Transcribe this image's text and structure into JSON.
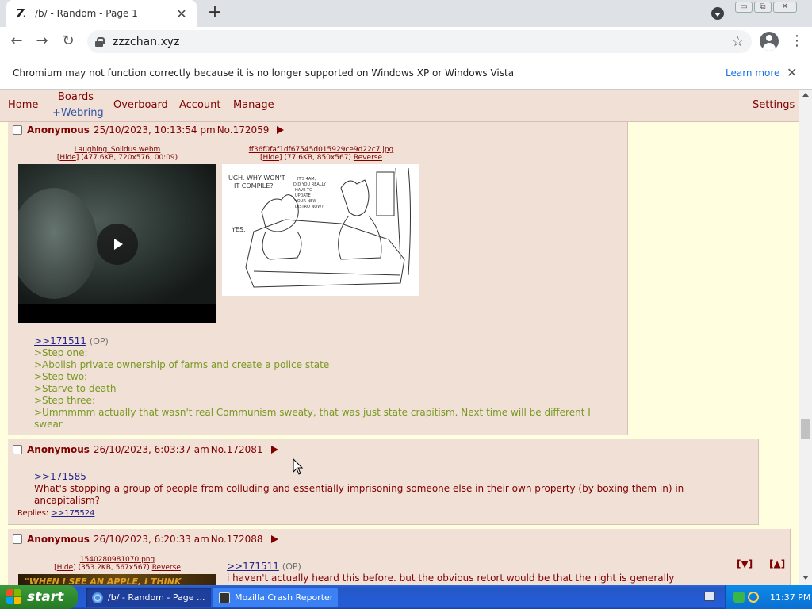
{
  "tab": {
    "favicon": "Z",
    "title": "/b/ - Random - Page 1",
    "close": "✕"
  },
  "newtab_label": "+",
  "window_buttons": [
    "▭",
    "⧉",
    "✕"
  ],
  "toolbar": {
    "url": "zzzchan.xyz",
    "back": "←",
    "forward": "→",
    "reload": "↻",
    "star": "☆",
    "menu": "⋮"
  },
  "infobar": {
    "text": "Chromium may not function correctly because it is no longer supported on Windows XP or Windows Vista",
    "link": "Learn more",
    "close": "✕"
  },
  "sitenav": {
    "home": "Home",
    "boards": "Boards",
    "webring": "+Webring",
    "overboard": "Overboard",
    "account": "Account",
    "manage": "Manage",
    "settings": "Settings"
  },
  "posts": [
    {
      "name": "Anonymous",
      "date": "25/10/2023, 10:13:54 pm",
      "number": "No.172059",
      "files": [
        {
          "name": "Laughing_Solidus.webm",
          "hide": "Hide",
          "meta": "(477.6KB, 720x576, 00:09)"
        },
        {
          "name": "ff36f0faf1df67545d015929ce9d22c7.jpg",
          "hide": "Hide",
          "meta": "(77.6KB, 850x567)",
          "reverse": "Reverse"
        }
      ],
      "quote": ">>171511",
      "op_tag": "(OP)",
      "lines": [
        ">Step one:",
        ">Abolish private ownership of farms and create a police state",
        ">Step two:",
        ">Starve to death",
        ">Step three:",
        ">Ummmmm actually that wasn't real Communism sweaty, that was just state crapitism. Next time will be different I swear."
      ]
    },
    {
      "name": "Anonymous",
      "date": "26/10/2023, 6:03:37 am",
      "number": "No.172081",
      "quote": ">>171585",
      "text": "What's stopping a group of people from colluding and essentially imprisoning someone else in their own property (by boxing them in) in ancapitalism?",
      "replies_label": "Replies:",
      "replies": ">>175524"
    },
    {
      "name": "Anonymous",
      "date": "26/10/2023, 6:20:33 am",
      "number": "No.172088",
      "files": [
        {
          "name": "1540280981070.png",
          "hide": "Hide",
          "meta": "(353.2KB, 567x567)",
          "reverse": "Reverse"
        }
      ],
      "quote": ">>171511",
      "op_tag": "(OP)",
      "text": "i haven't actually heard this before. but the obvious retort would be that the right is generally philosophically",
      "image_text": "\"WHEN I SEE AN APPLE, I THINK"
    }
  ],
  "jump": {
    "down": "[▼]",
    "up": "[▲]"
  },
  "taskbar": {
    "start": "start",
    "items": [
      "/b/ - Random - Page ...",
      "Mozilla Crash Reporter"
    ],
    "clock": "11:37 PM"
  },
  "colors": {
    "post_bg": "#f0e0d6",
    "page_bg": "#ffffe0",
    "maroon": "#800000",
    "greentext": "#789922"
  }
}
